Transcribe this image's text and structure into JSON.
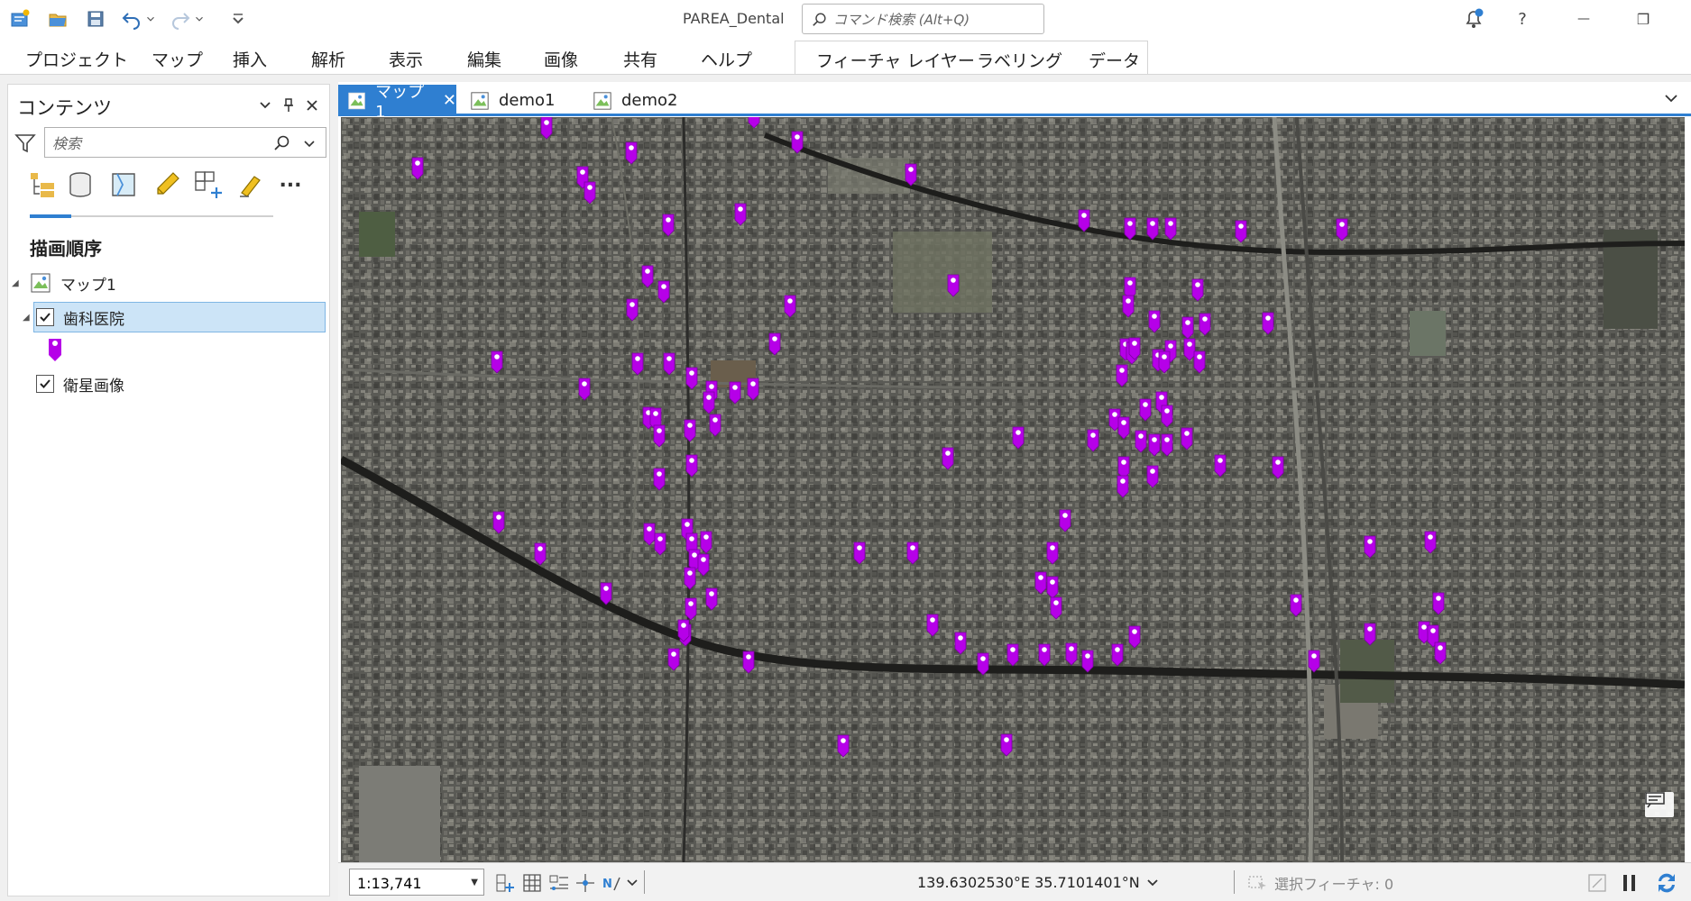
{
  "titlebar": {
    "app_title": "PAREA_Dental",
    "search_placeholder": "コマンド検索 (Alt+Q)",
    "help": "?",
    "minimize": "—",
    "restore": "❐"
  },
  "ribbon": {
    "tabs": [
      "プロジェクト",
      "マップ",
      "挿入",
      "解析",
      "表示",
      "編集",
      "画像",
      "共有",
      "ヘルプ"
    ],
    "context_tabs": [
      "フィーチャ レイヤー",
      "ラベリング",
      "データ"
    ]
  },
  "contents": {
    "title": "コンテンツ",
    "search_placeholder": "検索",
    "more_label": "...",
    "section": "描画順序",
    "map_name": "マップ1",
    "layers": [
      {
        "name": "歯科医院",
        "checked": true,
        "selected": true
      },
      {
        "name": "衛星画像",
        "checked": true,
        "selected": false
      }
    ]
  },
  "map": {
    "tabs": [
      {
        "label": "マップ1",
        "active": true
      },
      {
        "label": "demo1",
        "active": false
      },
      {
        "label": "demo2",
        "active": false
      }
    ],
    "marker_color": "#b600e8",
    "accent_color": "#2f7fd1"
  },
  "statusbar": {
    "scale": "1:13,741",
    "coordinates": "139.6302530°E 35.7101401°N",
    "selected_features": "選択フィーチャ: 0"
  }
}
